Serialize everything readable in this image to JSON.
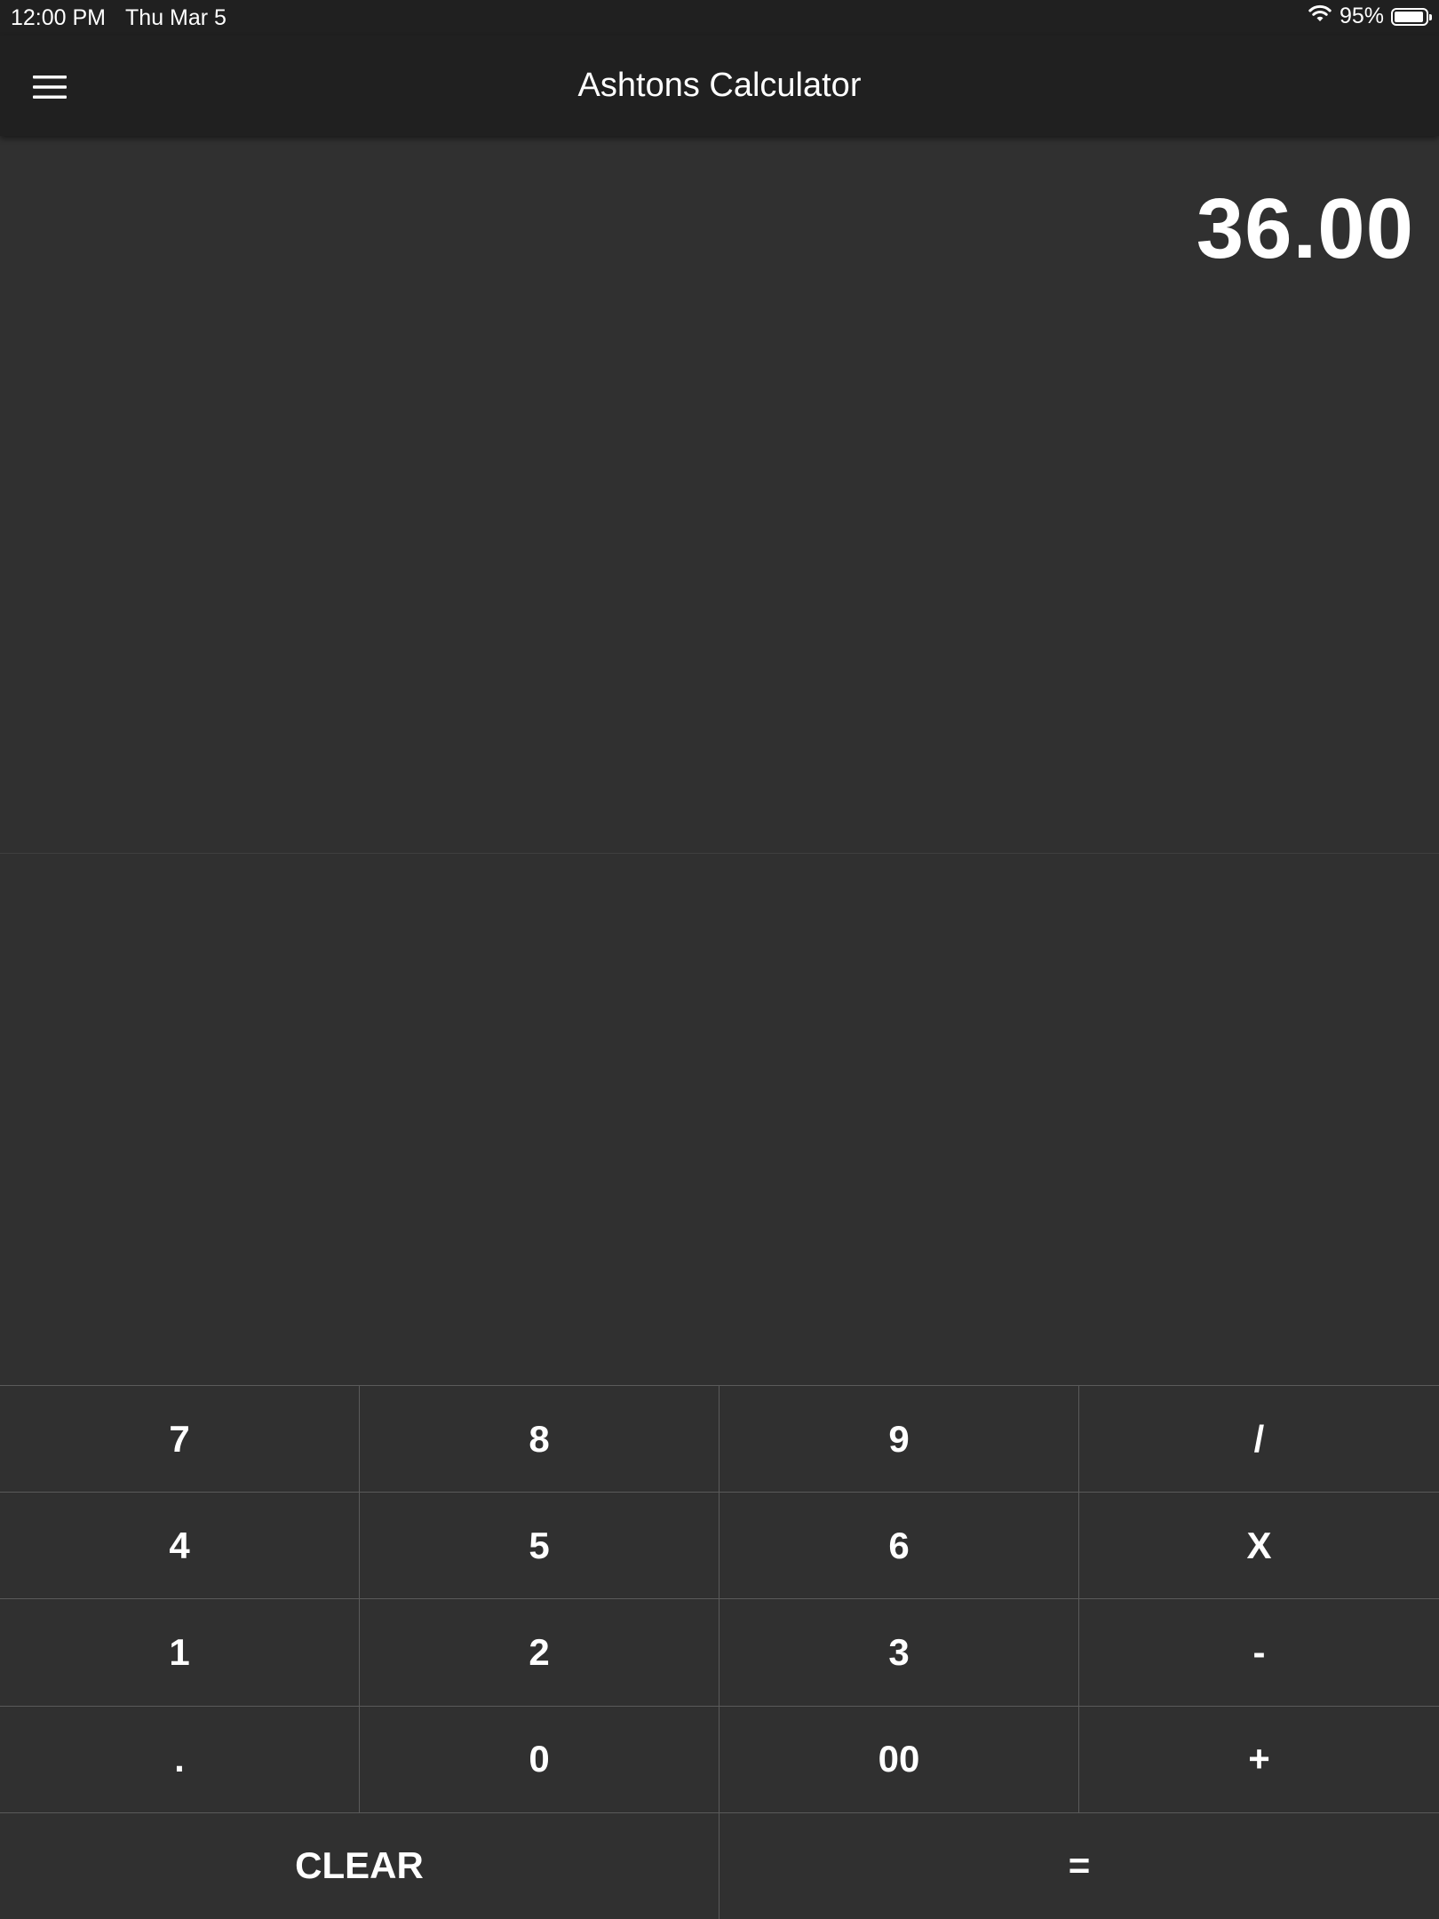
{
  "status_bar": {
    "time": "12:00 PM",
    "date": "Thu Mar 5",
    "battery_percent": "95%",
    "battery_level": 0.95,
    "wifi_icon": "wifi-icon",
    "battery_icon": "battery-icon"
  },
  "nav": {
    "title": "Ashtons Calculator",
    "menu_icon": "hamburger-menu-icon"
  },
  "display": {
    "result": "36.00"
  },
  "keypad": {
    "rows": [
      [
        "7",
        "8",
        "9",
        "/"
      ],
      [
        "4",
        "5",
        "6",
        "X"
      ],
      [
        "1",
        "2",
        "3",
        "-"
      ],
      [
        ".",
        "0",
        "00",
        "+"
      ]
    ],
    "clear_label": "CLEAR",
    "equals_label": "="
  },
  "colors": {
    "background": "#303030",
    "bar": "#202020",
    "text": "#ffffff",
    "key_border": "#5a5a5a"
  }
}
